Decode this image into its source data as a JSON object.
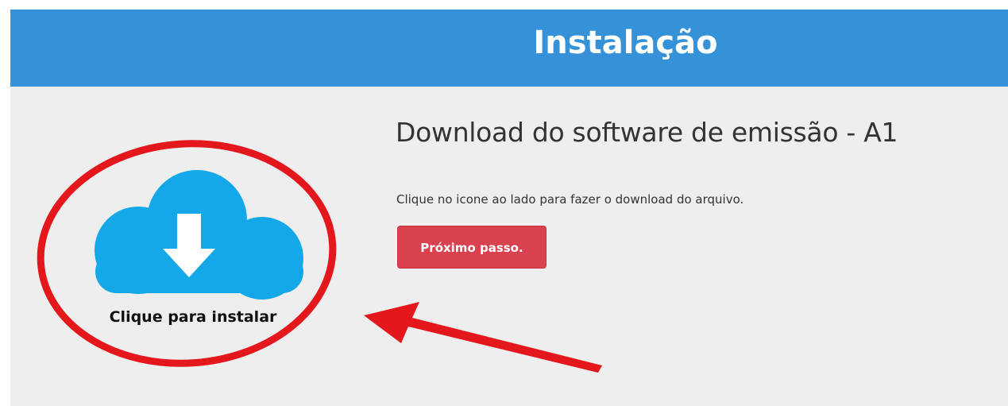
{
  "header": {
    "title": "Instalação",
    "background_color": "#3592d8"
  },
  "main": {
    "heading": "Download do software de emissão - A1",
    "instruction": "Clique no icone ao lado para fazer o download do arquivo.",
    "next_button_label": "Próximo passo.",
    "next_button_color": "#d9414f"
  },
  "download": {
    "icon": "cloud-download-icon",
    "label": "Clique para instalar",
    "icon_color": "#14a8e8"
  },
  "annotations": {
    "circle": "red-ellipse-highlight",
    "arrow": "red-arrow-pointer",
    "color": "#e3171c"
  }
}
